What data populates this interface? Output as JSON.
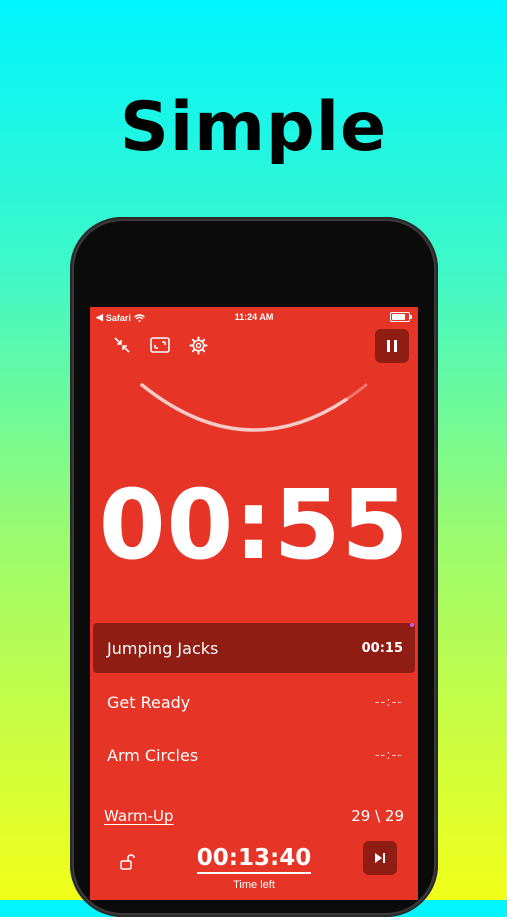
{
  "headline": "Simple",
  "status_bar": {
    "back_app": "Safari",
    "time": "11:24 AM"
  },
  "toolbar": {
    "icons": [
      "collapse-arrows-icon",
      "fullscreen-icon",
      "gear-icon"
    ],
    "pause_icon": "pause-icon"
  },
  "timer": {
    "main_time": "00:55",
    "progress": 0.9
  },
  "exercises": [
    {
      "name": "Jumping Jacks",
      "time": "00:15"
    },
    {
      "name": "Get Ready",
      "time": "--:--"
    },
    {
      "name": "Arm Circles",
      "time": "--:--"
    }
  ],
  "section": {
    "name": "Warm-Up",
    "count": "29 \\ 29"
  },
  "footer": {
    "total_time": "00:13:40",
    "total_label": "Time left",
    "lock_icon": "unlock-icon",
    "skip_icon": "skip-forward-icon"
  },
  "colors": {
    "screen_bg": "#e63526",
    "active_row": "#8f1d14"
  }
}
